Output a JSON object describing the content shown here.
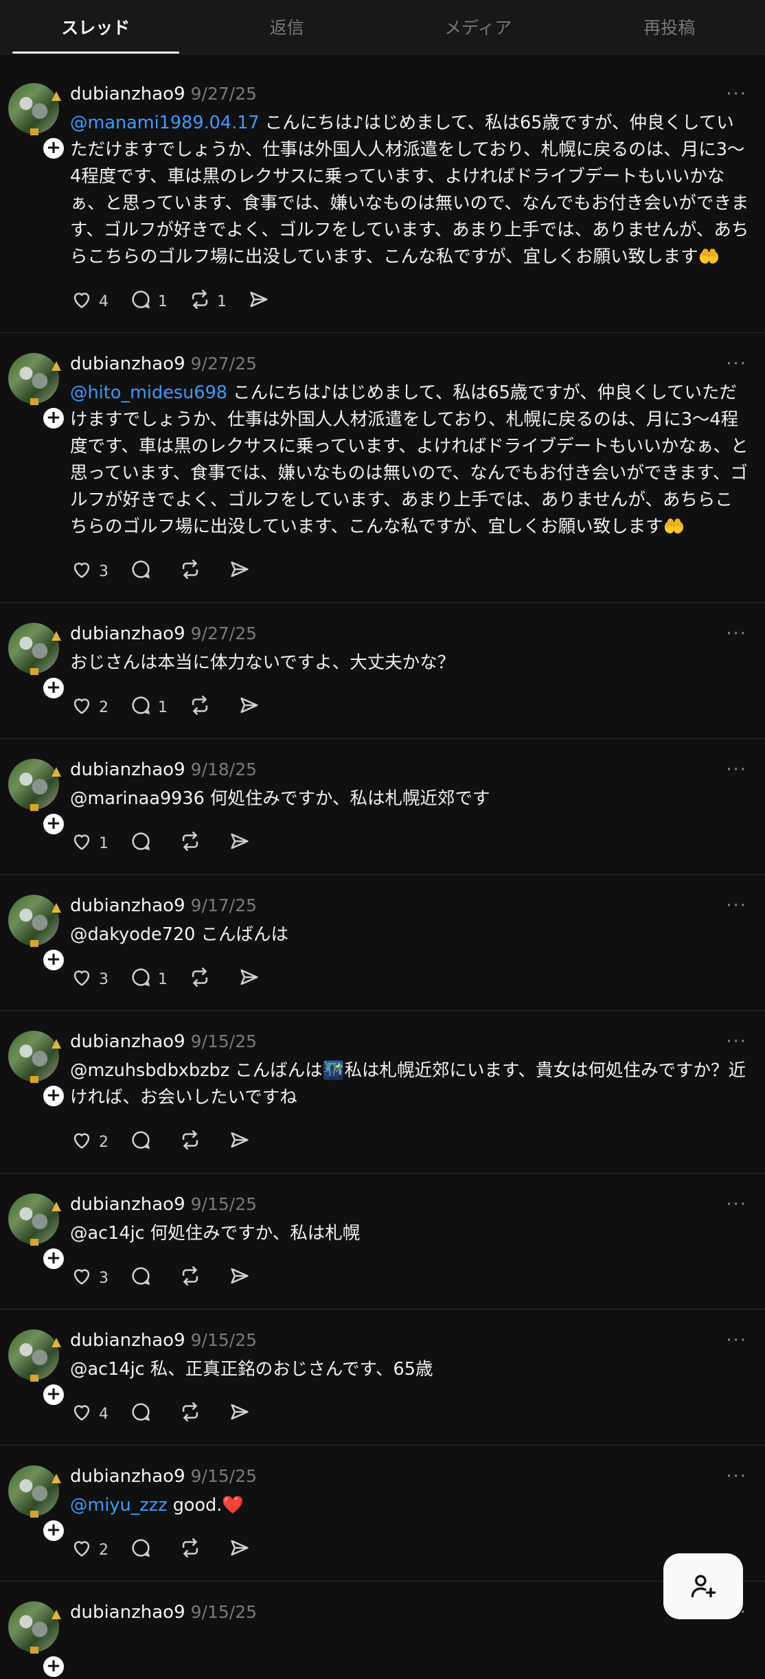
{
  "tabs": [
    "スレッド",
    "返信",
    "メディア",
    "再投稿"
  ],
  "active_tab": 0,
  "posts": [
    {
      "user": "dubianzhao9",
      "date": "9/27/25",
      "mention": "@manami1989.04.17",
      "mention_color": "blue",
      "text": " こんにちは♪はじめまして、私は65歳ですが、仲良くしていただけますでしょうか、仕事は外国人人材派遣をしており、札幌に戻るのは、月に3〜4程度です、車は黒のレクサスに乗っています、よければドライブデートもいいかなぁ、と思っています、食事では、嫌いなものは無いので、なんでもお付き会いができます、ゴルフが好きでよく、ゴルフをしています、あまり上手では、ありませんが、あちらこちらのゴルフ場に出没しています、こんな私ですが、宜しくお願い致します",
      "emoji": "🤲",
      "likes": "4",
      "replies": "1",
      "reposts": "1"
    },
    {
      "user": "dubianzhao9",
      "date": "9/27/25",
      "mention": "@hito_midesu698",
      "mention_color": "blue",
      "text": " こんにちは♪はじめまして、私は65歳ですが、仲良くしていただけますでしょうか、仕事は外国人人材派遣をしており、札幌に戻るのは、月に3〜4程度です、車は黒のレクサスに乗っています、よければドライブデートもいいかなぁ、と思っています、食事では、嫌いなものは無いので、なんでもお付き会いができます、ゴルフが好きでよく、ゴルフをしています、あまり上手では、ありませんが、あちらこちらのゴルフ場に出没しています、こんな私ですが、宜しくお願い致します",
      "emoji": "🤲",
      "likes": "3",
      "replies": "",
      "reposts": ""
    },
    {
      "user": "dubianzhao9",
      "date": "9/27/25",
      "mention": "",
      "mention_color": "",
      "text": "おじさんは本当に体力ないですよ、大丈夫かな？",
      "emoji": "",
      "likes": "2",
      "replies": "1",
      "reposts": ""
    },
    {
      "user": "dubianzhao9",
      "date": "9/18/25",
      "mention": "@marinaa9936",
      "mention_color": "white",
      "text": " 何処住みですか、私は札幌近郊です",
      "emoji": "",
      "likes": "1",
      "replies": "",
      "reposts": ""
    },
    {
      "user": "dubianzhao9",
      "date": "9/17/25",
      "mention": "@dakyode720",
      "mention_color": "white",
      "text": " こんばんは",
      "emoji": "",
      "likes": "3",
      "replies": "1",
      "reposts": ""
    },
    {
      "user": "dubianzhao9",
      "date": "9/15/25",
      "mention": "@mzuhsbdbxbzbz",
      "mention_color": "white",
      "text": " こんばんは🌃私は札幌近郊にいます、貴女は何処住みですか？近ければ、お会いしたいですね",
      "emoji": "",
      "likes": "2",
      "replies": "",
      "reposts": ""
    },
    {
      "user": "dubianzhao9",
      "date": "9/15/25",
      "mention": "@ac14jc",
      "mention_color": "white",
      "text": " 何処住みですか、私は札幌",
      "emoji": "",
      "likes": "3",
      "replies": "",
      "reposts": ""
    },
    {
      "user": "dubianzhao9",
      "date": "9/15/25",
      "mention": "@ac14jc",
      "mention_color": "white",
      "text": " 私、正真正銘のおじさんです、65歳",
      "emoji": "",
      "likes": "4",
      "replies": "",
      "reposts": ""
    },
    {
      "user": "dubianzhao9",
      "date": "9/15/25",
      "mention": "@miyu_zzz",
      "mention_color": "blue",
      "text": " good.",
      "emoji": "❤️",
      "likes": "2",
      "replies": "",
      "reposts": ""
    },
    {
      "user": "dubianzhao9",
      "date": "9/15/25",
      "mention": "",
      "mention_color": "",
      "text": "",
      "emoji": "",
      "likes": "",
      "replies": "",
      "reposts": "",
      "partial": true
    }
  ],
  "more_glyph": "···",
  "plus_glyph": "+",
  "fab_icon": "add-person-icon",
  "colors": {
    "background": "#101010",
    "mention": "#3b9bff",
    "muted": "#7a7a7a"
  }
}
